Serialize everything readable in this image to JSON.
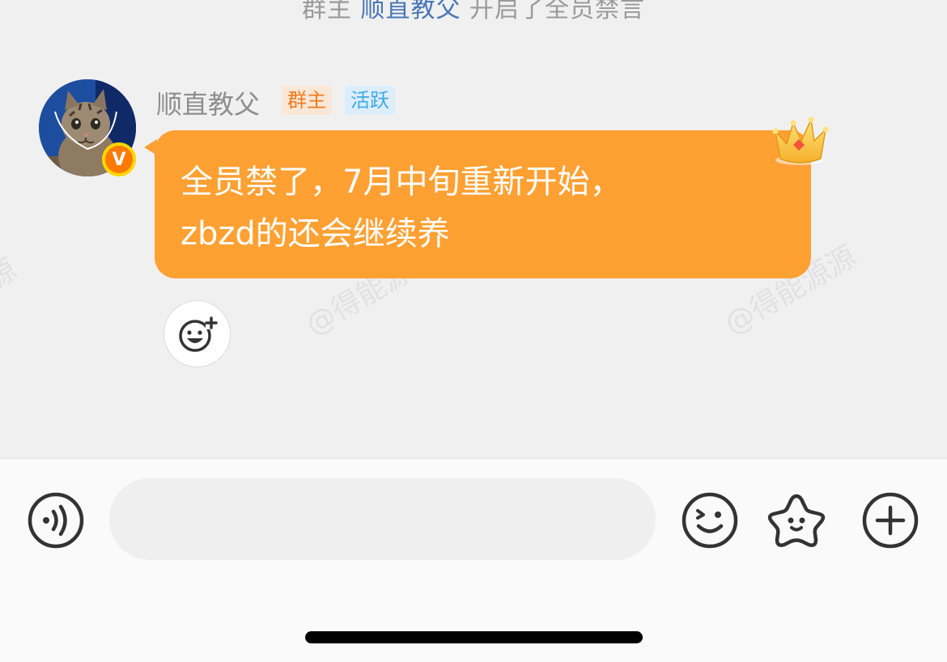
{
  "system_notice": {
    "prefix": "群主",
    "name": "顺直教父",
    "suffix": "开启了全员禁言"
  },
  "watermarks": [
    "源",
    "@得能源",
    "@得能源源"
  ],
  "message": {
    "sender_name": "顺直教父",
    "tags": {
      "owner": "群主",
      "active": "活跃"
    },
    "badge": "V",
    "text_line1": "全员禁了，7月中旬重新开始，",
    "text_line2": "zbzd的还会继续养"
  },
  "composer": {
    "input_value": "",
    "input_placeholder": ""
  },
  "icons": {
    "voice": "voice-wave-icon",
    "emoji": "wink-face-icon",
    "sticker": "star-face-icon",
    "more": "plus-circle-icon",
    "reaction": "add-reaction-icon",
    "crown": "crown-icon"
  },
  "colors": {
    "bubble": "#ffa033",
    "owner_tag_bg": "#fbe7d6",
    "owner_tag_text": "#f07b20",
    "active_tag_bg": "#dceefb",
    "active_tag_text": "#3fa9e8",
    "system_link": "#4a76b8"
  }
}
